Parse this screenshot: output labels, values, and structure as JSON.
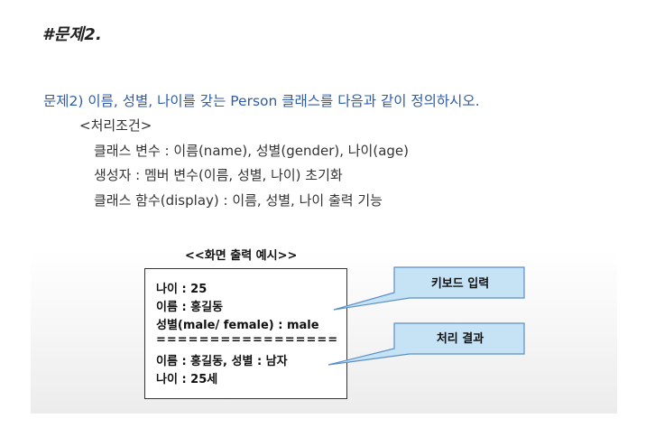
{
  "heading": "#문제2.",
  "slide": {
    "problem": "문제2) 이름, 성별, 나이를 갖는 Person 클래스를 다음과 같이 정의하시오.",
    "conditions_title": "<처리조건>",
    "conditions": [
      "클래스 변수 : 이름(name), 성별(gender), 나이(age)",
      "생성자 : 멤버 변수(이름, 성별, 나이) 초기화",
      "클래스 함수(display) : 이름, 성별, 나이 출력 기능"
    ],
    "example_title": "<<화면 출력 예시>>",
    "example_lines": [
      "나이 : 25",
      "이름 : 홍길동",
      "성별(male/ female) : male",
      "=================",
      "이름 : 홍길동, 성별 : 남자",
      "나이 : 25세"
    ],
    "callouts": [
      "키보드 입력",
      "처리 결과"
    ]
  },
  "colors": {
    "problem_text": "#2e5ca8",
    "callout_fill": "#c6e2f5",
    "callout_border": "#5b8fc7"
  }
}
